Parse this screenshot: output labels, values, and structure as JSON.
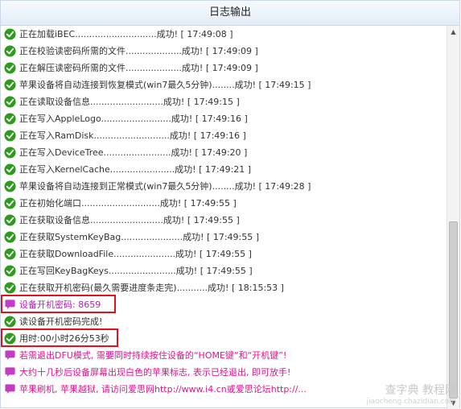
{
  "window": {
    "title": "日志输出"
  },
  "log": {
    "rows": [
      {
        "icon": "check",
        "text": "正在加载iBEC.............................成功! [ 17:49:08 ]"
      },
      {
        "icon": "check",
        "text": "正在校验读密码所需的文件....................成功! [ 17:49:09 ]"
      },
      {
        "icon": "check",
        "text": "正在解压读密码所需的文件....................成功! [ 17:49:09 ]"
      },
      {
        "icon": "check",
        "text": "苹果设备将自动连接到恢复模式(win7最久5分钟)........成功! [ 17:49:15 ]"
      },
      {
        "icon": "check",
        "text": "正在读取设备信息..........................成功! [ 17:49:15 ]"
      },
      {
        "icon": "check",
        "text": "正在写入AppleLogo.........................成功! [ 17:49:16 ]"
      },
      {
        "icon": "check",
        "text": "正在写入RamDisk...........................成功! [ 17:49:16 ]"
      },
      {
        "icon": "check",
        "text": "正在写入DeviceTree........................成功! [ 17:49:20 ]"
      },
      {
        "icon": "check",
        "text": "正在写入KernelCache.......................成功! [ 17:49:21 ]"
      },
      {
        "icon": "check",
        "text": "苹果设备将自动连接到正常模式(win7最久5分钟)........成功! [ 17:49:28 ]"
      },
      {
        "icon": "check",
        "text": "正在初始化端口............................成功! [ 17:49:55 ]"
      },
      {
        "icon": "check",
        "text": "正在获取设备信息..........................成功! [ 17:49:55 ]"
      },
      {
        "icon": "check",
        "text": "正在获取SystemKeyBag......................成功! [ 17:49:55 ]"
      },
      {
        "icon": "check",
        "text": "正在获取DownloadFile......................成功! [ 17:49:55 ]"
      },
      {
        "icon": "check",
        "text": "正在写回KeyBagKeys........................成功! [ 17:49:55 ]"
      },
      {
        "icon": "check",
        "text": "正在获取开机密码(最久需要进度条走完)...........成功! [ 18:15:53 ]"
      },
      {
        "icon": "message",
        "text": "设备开机密码: 8659"
      },
      {
        "icon": "check",
        "text": "读设备开机密码完成!"
      },
      {
        "icon": "check",
        "text": "用时:00小时26分53秒"
      },
      {
        "icon": "message",
        "text": "若需退出DFU模式, 需要同时持续按住设备的“HOME键”和“开机键”!"
      },
      {
        "icon": "message",
        "text": "大约十几秒后设备屏幕出现白色的苹果标志, 表示已经退出, 即可放手!"
      },
      {
        "icon": "message",
        "text": "苹果刷机, 苹果越狱, 请访问爱思网http://www.i4.cn或爱思论坛http://..."
      }
    ]
  },
  "colors": {
    "success": "#2e9a1e",
    "message": "#c23cc6",
    "highlight": "#e0121f",
    "pink_text": "#e0148c"
  },
  "watermark": {
    "main": "查字典 教程网",
    "sub": "jiaocheng.chazidian.com"
  }
}
